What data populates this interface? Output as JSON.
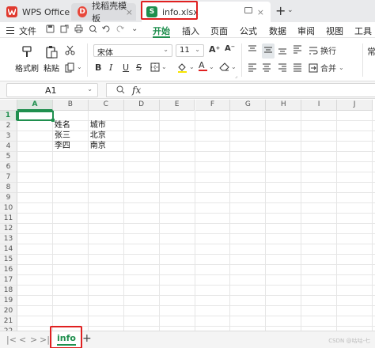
{
  "titlebar": {
    "tabs": [
      {
        "label": "WPS Office"
      },
      {
        "label": "找稻壳模板"
      },
      {
        "label": "info.xlsx"
      }
    ],
    "close_glyph": "×",
    "new_tab_glyph": "+",
    "menu_glyph": "⌄"
  },
  "menubar": {
    "file_label": "文件",
    "tabs": [
      "开始",
      "插入",
      "页面",
      "公式",
      "数据",
      "审阅",
      "视图",
      "工具"
    ],
    "active_tab": "开始"
  },
  "ribbon": {
    "format_painter": "格式刷",
    "paste": "粘贴",
    "font_name": "宋体",
    "font_size": "11",
    "wrap_label": "换行",
    "merge_label": "合并",
    "bold": "B",
    "italic": "I",
    "underline": "U",
    "strike": "S",
    "font_color_letter": "A",
    "overflow_char": "常",
    "font_grow": "A⁺",
    "font_shrink": "A⁻"
  },
  "formula_bar": {
    "cell_ref": "A1",
    "fx": "fx",
    "value": ""
  },
  "grid": {
    "columns": [
      "A",
      "B",
      "C",
      "D",
      "E",
      "F",
      "G",
      "H",
      "I",
      "J"
    ],
    "rows": [
      "1",
      "2",
      "3",
      "4",
      "5",
      "6",
      "7",
      "8",
      "9",
      "10",
      "11",
      "12",
      "13",
      "14",
      "15",
      "16",
      "17",
      "18",
      "19",
      "20",
      "21",
      "22"
    ],
    "selected_col": "A",
    "selected_row": "1",
    "cells": {
      "B2": "姓名",
      "C2": "城市",
      "B3": "张三",
      "C3": "北京",
      "B4": "李四",
      "C4": "南京"
    }
  },
  "sheetbar": {
    "nav": [
      "|<",
      "<",
      ">",
      ">|"
    ],
    "active_sheet": "info",
    "add_glyph": "+",
    "watermark": "CSDN @咕咕-七"
  },
  "colors": {
    "accent": "#1f8f4e",
    "highlight_box": "#e02020",
    "wps_red": "#e03a2f"
  }
}
